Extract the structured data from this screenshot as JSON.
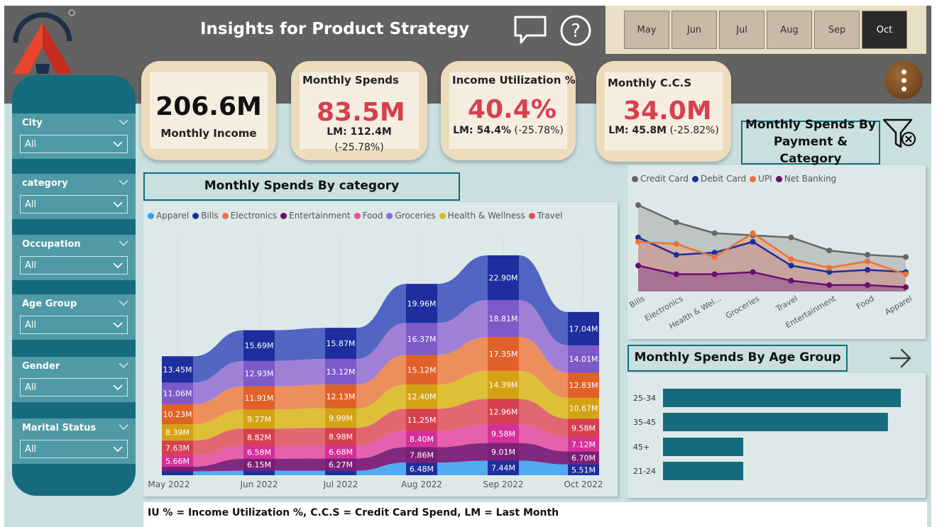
{
  "header": {
    "title": "Insights for Product Strategy",
    "months": [
      "May",
      "Jun",
      "Jul",
      "Aug",
      "Sep",
      "Oct"
    ],
    "selected_month": "Oct",
    "icons": [
      "chat-icon",
      "help-icon",
      "more-vertical-icon"
    ]
  },
  "kpis": {
    "income": {
      "value": "206.6M",
      "label": "Monthly Income"
    },
    "spends": {
      "title": "Monthly Spends",
      "value": "83.5M",
      "warn": "!",
      "lm": "LM: 112.4M",
      "delta": "(-25.78%)"
    },
    "utilization": {
      "title": "Income Utilization %",
      "value": "40.4%",
      "warn": "!",
      "lm_bold": "LM: 54.4%",
      "delta": " (-25.78%)"
    },
    "ccs": {
      "title": "Monthly C.C.S",
      "value": "34.0M",
      "warn": "!",
      "lm_bold": "LM: 45.8M",
      "delta": " (-25.82%)"
    }
  },
  "filters": [
    {
      "label": "City",
      "value": "All"
    },
    {
      "label": "category",
      "value": "All"
    },
    {
      "label": "Occupation",
      "value": "All"
    },
    {
      "label": "Age Group",
      "value": "All"
    },
    {
      "label": "Gender",
      "value": "All"
    },
    {
      "label": "Marital Status",
      "value": "All"
    }
  ],
  "sections": {
    "category": "Monthly Spends By category",
    "payment_line1": "Monthly Spends By",
    "payment_line2": "Payment & Category",
    "age": "Monthly Spends By Age Group"
  },
  "footer": "IU % = Income Utilization %, C.C.S = Credit Card Spend, LM = Last Month",
  "colors": {
    "accent_red": "#d6404f",
    "teal": "#156b7d",
    "header_gray": "#626262"
  },
  "chart_data": [
    {
      "type": "area",
      "title": "Monthly Spends By category",
      "categories": [
        "May 2022",
        "Jun 2022",
        "Jul 2022",
        "Aug 2022",
        "Sep 2022",
        "Oct 2022"
      ],
      "legend_position": "top-left",
      "series": [
        {
          "name": "Apparel",
          "color": "#3aa0f0",
          "values": [
            null,
            null,
            null,
            6.48,
            7.44,
            5.51
          ],
          "labels": [
            "",
            "",
            "",
            "6.48M",
            "7.44M",
            "5.51M"
          ]
        },
        {
          "name": "Bills",
          "color": "#1f2e9e",
          "values": [
            null,
            null,
            null,
            null,
            null,
            null
          ],
          "labels": [
            "",
            "",
            "",
            "",
            "",
            ""
          ]
        },
        {
          "name": "Electronics",
          "color": "#e8743b",
          "values": [
            null,
            null,
            null,
            null,
            null,
            null
          ],
          "labels": [
            "",
            "",
            "",
            "",
            "",
            ""
          ]
        },
        {
          "name": "Entertainment",
          "color": "#6a0d6e",
          "values": [
            null,
            6.15,
            6.27,
            7.86,
            9.01,
            6.7
          ],
          "labels": [
            "",
            "6.15M",
            "6.27M",
            "7.86M",
            "9.01M",
            "6.70M"
          ]
        },
        {
          "name": "Food",
          "color": "#e252a5",
          "values": [
            5.66,
            6.58,
            6.68,
            8.4,
            9.58,
            7.12
          ],
          "labels": [
            "5.66M",
            "6.58M",
            "6.68M",
            "8.40M",
            "9.58M",
            "7.12M"
          ]
        },
        {
          "name": "Groceries",
          "color": "#8e6fd6",
          "values": [
            7.63,
            8.82,
            8.98,
            11.25,
            12.96,
            9.58
          ],
          "labels": [
            "7.63M",
            "8.82M",
            "8.98M",
            "11.25M",
            "12.96M",
            "9.58M"
          ]
        },
        {
          "name": "Health & Wellness",
          "color": "#d9b72a",
          "values": [
            8.39,
            9.77,
            9.99,
            12.4,
            14.39,
            10.67
          ],
          "labels": [
            "8.39M",
            "9.77M",
            "9.99M",
            "12.40M",
            "14.39M",
            "10.67M"
          ]
        },
        {
          "name": "Travel",
          "color": "#e04f5f",
          "values": [
            10.23,
            11.91,
            12.13,
            15.12,
            17.35,
            12.83
          ],
          "labels": [
            "10.23M",
            "11.91M",
            "12.13M",
            "15.12M",
            "17.35M",
            "12.83M"
          ]
        },
        {
          "name": "",
          "color": "#e8743b",
          "values": [
            11.06,
            12.93,
            13.12,
            16.37,
            18.81,
            14.01
          ],
          "labels": [
            "11.06M",
            "12.93M",
            "13.12M",
            "16.37M",
            "18.81M",
            "14.01M"
          ]
        },
        {
          "name": "",
          "color": "#8e6fd6",
          "values": [
            13.45,
            15.69,
            15.87,
            19.96,
            22.9,
            17.04
          ],
          "labels": [
            "13.45M",
            "15.69M",
            "15.87M",
            "19.96M",
            "22.90M",
            "17.04M"
          ]
        }
      ],
      "bands": [
        {
          "color": "#4aa8f2"
        },
        {
          "color": "#7a1f78"
        },
        {
          "color": "#e55aa8"
        },
        {
          "color": "#e0606c"
        },
        {
          "color": "#ddbd2e"
        },
        {
          "color": "#ec8a55"
        },
        {
          "color": "#9c7ad6"
        },
        {
          "color": "#4a5ec0"
        }
      ],
      "label_fill": [
        [
          "#1f2e9e",
          "#7a1f78",
          "#d5309a",
          "#d6404f",
          "#d4a315",
          "#e0622a",
          "#7c5bc8",
          "#1f2e9e"
        ]
      ],
      "stack_labels": [
        [
          "",
          "",
          "5.66M",
          "7.63M",
          "8.39M",
          "10.23M",
          "11.06M",
          "13.45M"
        ],
        [
          "",
          "6.15M",
          "6.58M",
          "8.82M",
          "9.77M",
          "11.91M",
          "12.93M",
          "15.69M"
        ],
        [
          "",
          "6.27M",
          "6.68M",
          "8.98M",
          "9.99M",
          "12.13M",
          "13.12M",
          "15.87M"
        ],
        [
          "6.48M",
          "7.86M",
          "8.40M",
          "11.25M",
          "12.40M",
          "15.12M",
          "16.37M",
          "19.96M"
        ],
        [
          "7.44M",
          "9.01M",
          "9.58M",
          "12.96M",
          "14.39M",
          "17.35M",
          "18.81M",
          "22.90M"
        ],
        [
          "5.51M",
          "6.70M",
          "7.12M",
          "9.58M",
          "10.67M",
          "12.83M",
          "14.01M",
          "17.04M"
        ]
      ],
      "stack_values": [
        [
          2.0,
          2.4,
          5.66,
          7.63,
          8.39,
          10.23,
          11.06,
          13.45
        ],
        [
          2.3,
          6.15,
          6.58,
          8.82,
          9.77,
          11.91,
          12.93,
          15.69
        ],
        [
          2.3,
          6.27,
          6.68,
          8.98,
          9.99,
          12.13,
          13.12,
          15.87
        ],
        [
          6.48,
          7.86,
          8.4,
          11.25,
          12.4,
          15.12,
          16.37,
          19.96
        ],
        [
          7.44,
          9.01,
          9.58,
          12.96,
          14.39,
          17.35,
          18.81,
          22.9
        ],
        [
          5.51,
          6.7,
          7.12,
          9.58,
          10.67,
          12.83,
          14.01,
          17.04
        ]
      ]
    },
    {
      "type": "area",
      "title": "Monthly Spends By Payment & Category",
      "categories": [
        "Bills",
        "Electronics",
        "Health & Wel...",
        "Groceries",
        "Travel",
        "Entertainment",
        "Food",
        "Apparel"
      ],
      "legend_position": "top-left",
      "series": [
        {
          "name": "Credit Card",
          "color": "#666666",
          "values": [
            34,
            26,
            21,
            20,
            19,
            13,
            11,
            10
          ]
        },
        {
          "name": "Debit Card",
          "color": "#1a2ea0",
          "values": [
            19,
            11,
            12,
            17,
            6,
            3,
            4,
            3
          ]
        },
        {
          "name": "UPI",
          "color": "#e8743b",
          "values": [
            17,
            16,
            10,
            21,
            9,
            5,
            8,
            2
          ]
        },
        {
          "name": "Net Banking",
          "color": "#6a0d6e",
          "values": [
            6,
            2,
            2,
            3,
            -1,
            -3,
            -3,
            -4
          ]
        }
      ]
    },
    {
      "type": "bar",
      "title": "Monthly Spends By Age Group",
      "categories": [
        "25-34",
        "35-45",
        "45+",
        "21-24"
      ],
      "values": [
        33.2,
        31.4,
        11.2,
        11.2
      ],
      "color": "#156b7d"
    }
  ]
}
